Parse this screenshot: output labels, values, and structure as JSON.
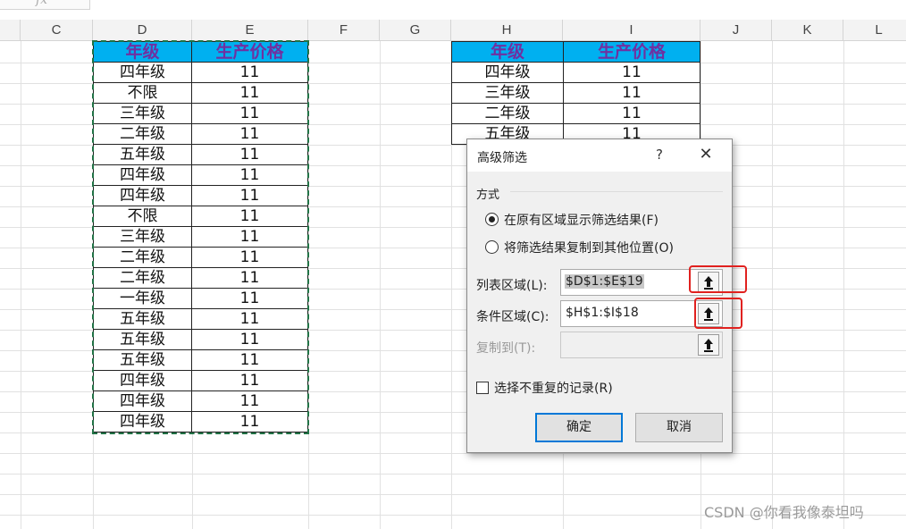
{
  "formula_bar": {
    "fx_label": "fx"
  },
  "columns": [
    "C",
    "D",
    "E",
    "F",
    "G",
    "H",
    "I",
    "J",
    "K",
    "L"
  ],
  "list_table": {
    "headers": [
      "年级",
      "生产价格"
    ],
    "rows": [
      [
        "四年级",
        "11"
      ],
      [
        "不限",
        "11"
      ],
      [
        "三年级",
        "11"
      ],
      [
        "二年级",
        "11"
      ],
      [
        "五年级",
        "11"
      ],
      [
        "四年级",
        "11"
      ],
      [
        "四年级",
        "11"
      ],
      [
        "不限",
        "11"
      ],
      [
        "三年级",
        "11"
      ],
      [
        "二年级",
        "11"
      ],
      [
        "二年级",
        "11"
      ],
      [
        "一年级",
        "11"
      ],
      [
        "五年级",
        "11"
      ],
      [
        "五年级",
        "11"
      ],
      [
        "五年级",
        "11"
      ],
      [
        "四年级",
        "11"
      ],
      [
        "四年级",
        "11"
      ],
      [
        "四年级",
        "11"
      ]
    ]
  },
  "criteria_table": {
    "headers": [
      "年级",
      "生产价格"
    ],
    "rows": [
      [
        "四年级",
        "11"
      ],
      [
        "三年级",
        "11"
      ],
      [
        "二年级",
        "11"
      ],
      [
        "五年级",
        "11"
      ]
    ]
  },
  "dialog": {
    "title": "高级筛选",
    "help": "?",
    "close": "✕",
    "group_label": "方式",
    "option_filter_in_place": "在原有区域显示筛选结果(F)",
    "option_copy_to": "将筛选结果复制到其他位置(O)",
    "list_range_label": "列表区域(L):",
    "list_range_value": "$D$1:$E$19",
    "criteria_range_label": "条件区域(C):",
    "criteria_range_value": "$H$1:$I$18",
    "copy_to_label": "复制到(T):",
    "copy_to_value": "",
    "unique_records_label": "选择不重复的记录(R)",
    "ok_label": "确定",
    "cancel_label": "取消",
    "selected_option": "filter_in_place",
    "unique_records_checked": false
  },
  "watermark": "CSDN @你看我像泰坦吗",
  "colors": {
    "header_fill": "#00b0f0",
    "header_text": "#7030a0",
    "marching_ants": "#217346",
    "highlight": "#e0211f",
    "primary_border": "#0078d7"
  }
}
